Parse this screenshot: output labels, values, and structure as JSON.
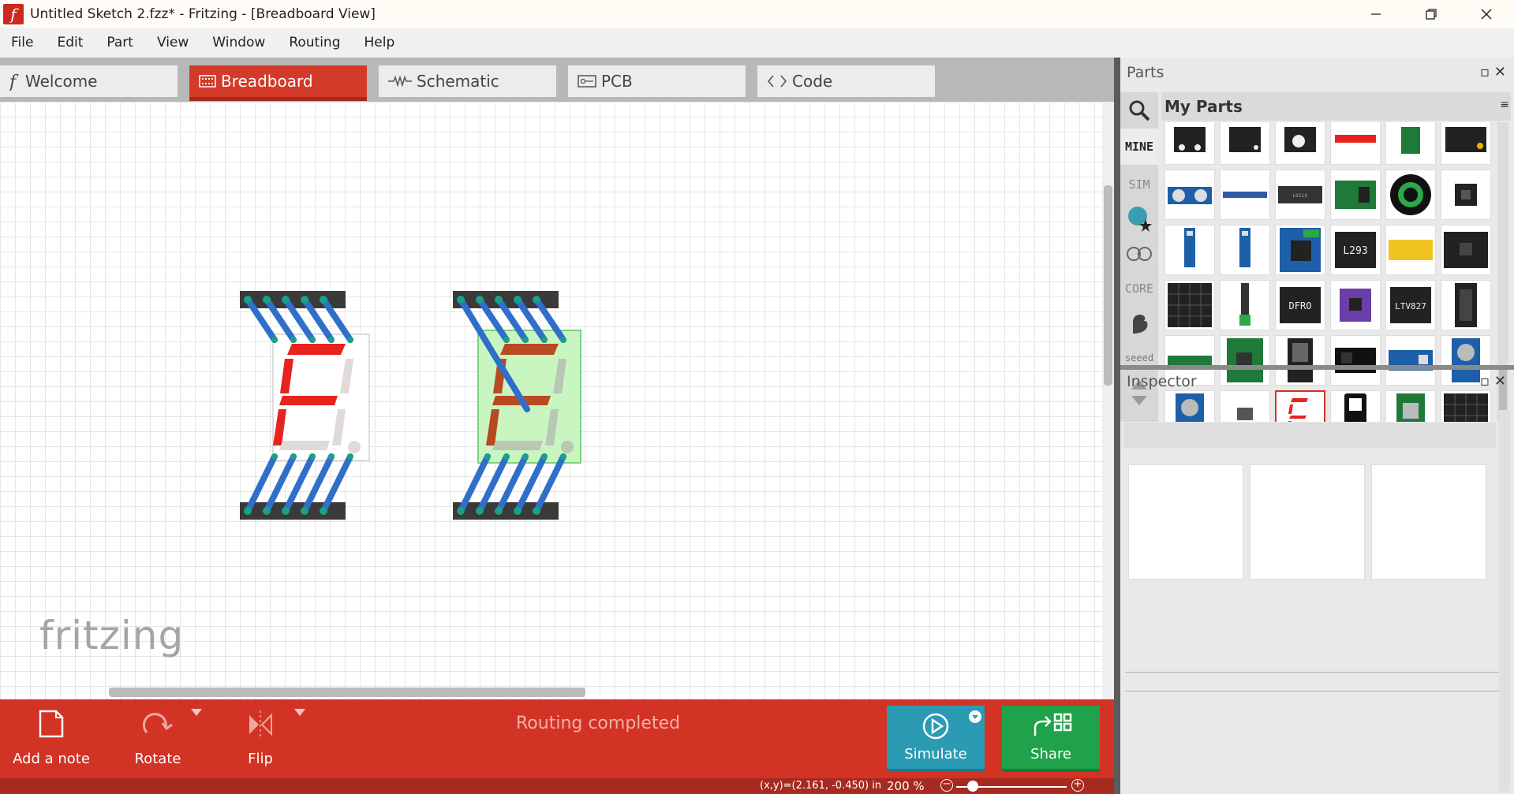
{
  "window": {
    "title": "Untitled Sketch 2.fzz* - Fritzing - [Breadboard View]",
    "app_icon_letter": "f",
    "controls": [
      "minimize-icon",
      "restore-icon",
      "close-icon"
    ]
  },
  "menu": [
    "File",
    "Edit",
    "Part",
    "View",
    "Window",
    "Routing",
    "Help"
  ],
  "tabs": [
    {
      "label": "Welcome",
      "icon": "fritzing-f-icon",
      "active": false
    },
    {
      "label": "Breadboard",
      "icon": "breadboard-icon",
      "active": true
    },
    {
      "label": "Schematic",
      "icon": "resistor-icon",
      "active": false
    },
    {
      "label": "PCB",
      "icon": "pcb-icon",
      "active": false
    },
    {
      "label": "Code",
      "icon": "code-brackets-icon",
      "active": false
    }
  ],
  "canvas": {
    "watermark": "fritzing",
    "parts": [
      {
        "type": "seven-segment-display",
        "state": "normal",
        "segment_color": "#e8231e"
      },
      {
        "type": "seven-segment-display",
        "state": "selected",
        "segment_color": "#b84a22",
        "highlight": "#c8f5c0"
      }
    ],
    "wire_color": "#2f6fc9"
  },
  "toolbar": {
    "add_note": "Add a note",
    "rotate": "Rotate",
    "flip": "Flip",
    "status": "Routing completed",
    "simulate": "Simulate",
    "share": "Share"
  },
  "statusbar": {
    "coords": "(x,y)=(2.161, -0.450) in",
    "zoom": "200 %"
  },
  "parts_panel": {
    "title": "Parts",
    "bin_name": "My Parts",
    "bin_tabs": [
      "MINE",
      "SIM",
      "adafruit-icon",
      "arduino-icon",
      "CORE",
      "sparkfun-icon",
      "seeed"
    ],
    "grid_part_labels": [
      "L9110",
      "L293",
      "DFRO",
      "LTV827"
    ]
  },
  "inspector": {
    "title": "Inspector"
  },
  "colors": {
    "accent_red": "#d23325",
    "simulate_blue": "#2b9bb4",
    "share_green": "#1fa24a"
  }
}
